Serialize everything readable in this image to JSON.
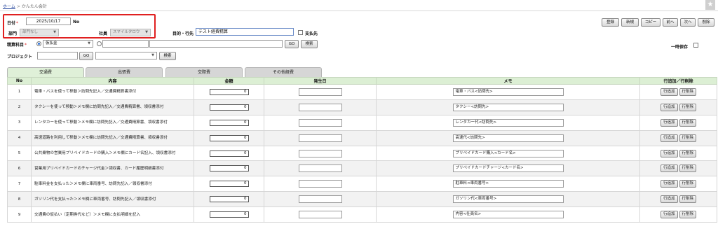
{
  "breadcrumb": {
    "home": "ホーム",
    "separator": ">",
    "current": "かんたん会計"
  },
  "form": {
    "date_label": "日付",
    "required_mark": "*",
    "date_value": "2025/10/17",
    "no_label": "No",
    "dept_label": "部門",
    "dept_value": "部門なし",
    "staff_label": "社員",
    "staff_value": "スマイルタロウ",
    "purpose_label": "目的・行先",
    "purpose_value": "テスト経費精算",
    "payee_label": "支払先",
    "account_label": "精算科目",
    "account_value": "仮払金",
    "project_label": "プロジェクト",
    "go_label": "GO",
    "search_label": "検索",
    "temp_save_label": "一時保存"
  },
  "toolbar": {
    "register": "登録",
    "new": "新規",
    "copy": "コピー",
    "prev": "前へ",
    "next": "次へ",
    "delete": "削除"
  },
  "tabs": [
    {
      "label": "交通費",
      "active": true
    },
    {
      "label": "出張費",
      "active": false
    },
    {
      "label": "交際費",
      "active": false
    },
    {
      "label": "その他経費",
      "active": false
    }
  ],
  "table": {
    "headers": [
      "No",
      "内容",
      "金額",
      "発生日",
      "メモ",
      "行追加／行削除"
    ],
    "add_label": "行追加",
    "remove_label": "行削除",
    "rows": [
      {
        "no": "1",
        "desc": "電車・バスを使って移動＞訪問先記入／交通費精算書添付",
        "amount": "0",
        "memo": "電車・バス<訪問先>"
      },
      {
        "no": "2",
        "desc": "タクシーを使って移動＞メモ欄に訪問先記入／交通費精算書、領収書添付",
        "amount": "0",
        "memo": "タクシー<訪問先>"
      },
      {
        "no": "3",
        "desc": "レンタカーを使って移動＞メモ欄に訪問先記入／交通費精算書、領収書添付",
        "amount": "0",
        "memo": "レンタカー代<訪問先>"
      },
      {
        "no": "4",
        "desc": "高速道路を利用して移動＞メモ欄に訪問先記入／交通費精算書、領収書添付",
        "amount": "0",
        "memo": "高速代<訪問先>"
      },
      {
        "no": "5",
        "desc": "公共乗物の営業用プリペイドカードの購入＞メモ欄にカード名記入、領収書添付",
        "amount": "0",
        "memo": "プリペイドカード購入<カード名>"
      },
      {
        "no": "6",
        "desc": "営業用プリペイドカードのチャージ代金＞領収書、カード履歴明細書添付",
        "amount": "0",
        "memo": "プリペイドカードチャージ<カード名>"
      },
      {
        "no": "7",
        "desc": "駐車料金を支払った＞メモ欄に車両番号、訪問先記入／領収書添付",
        "amount": "0",
        "memo": "駐車料<車両番号>"
      },
      {
        "no": "8",
        "desc": "ガソリン代を支払った＞メモ欄に車両番号、訪問先記入／領収書添付",
        "amount": "0",
        "memo": "ガソリン代<車両番号>"
      },
      {
        "no": "9",
        "desc": "交通費の仮払い（定期券代など）＞メモ欄に支払明細を記入",
        "amount": "0",
        "memo": "内容<仕員名>"
      }
    ]
  }
}
